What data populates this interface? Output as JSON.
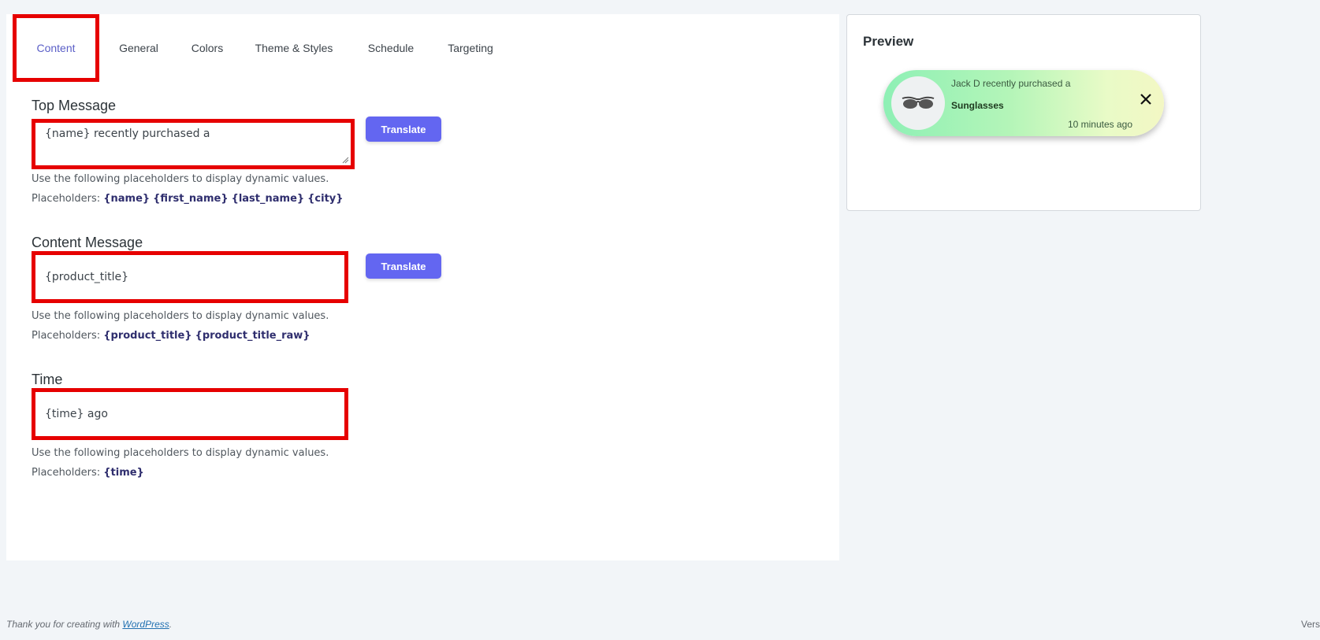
{
  "tabs": [
    {
      "label": "Content",
      "active": true
    },
    {
      "label": "General",
      "active": false
    },
    {
      "label": "Colors",
      "active": false
    },
    {
      "label": "Theme & Styles",
      "active": false
    },
    {
      "label": "Schedule",
      "active": false
    },
    {
      "label": "Targeting",
      "active": false
    }
  ],
  "sections": {
    "top_message": {
      "title": "Top Message",
      "value": "{name} recently purchased a",
      "button": "Translate",
      "help": "Use the following placeholders to display dynamic values.",
      "placeholders_label": "Placeholders:",
      "placeholders": [
        "{name}",
        "{first_name}",
        "{last_name}",
        "{city}"
      ]
    },
    "content_message": {
      "title": "Content Message",
      "value": "{product_title}",
      "button": "Translate",
      "help": "Use the following placeholders to display dynamic values.",
      "placeholders_label": "Placeholders:",
      "placeholders": [
        "{product_title}",
        "{product_title_raw}"
      ]
    },
    "time": {
      "title": "Time",
      "value": "{time} ago",
      "help": "Use the following placeholders to display dynamic values.",
      "placeholders_label": "Placeholders:",
      "placeholders": [
        "{time}"
      ]
    }
  },
  "preview": {
    "title": "Preview",
    "top": "Jack D recently purchased a",
    "product": "Sunglasses",
    "time": "10 minutes ago",
    "product_icon": "sunglasses-icon",
    "close_icon": "close-icon"
  },
  "footer": {
    "text": "Thank you for creating with ",
    "link": "WordPress",
    "suffix": ".",
    "version": "Vers"
  },
  "colors": {
    "accent": "#6366f1",
    "highlight": "#e60000",
    "active_tab": "#5b5fc7"
  }
}
